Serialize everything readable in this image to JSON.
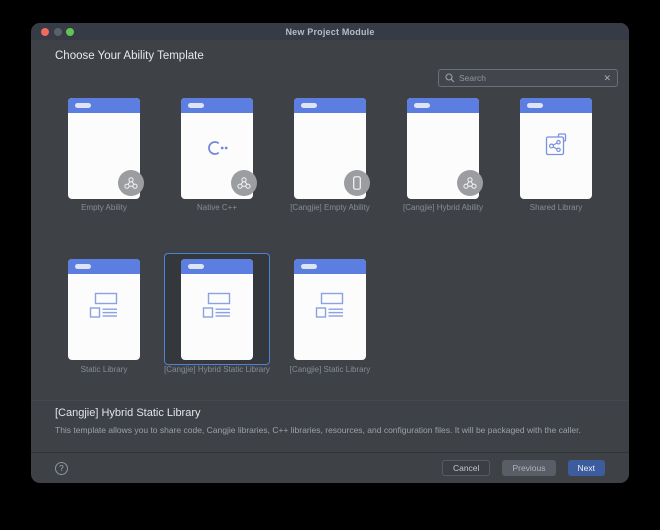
{
  "titlebar": {
    "title": "New Project Module"
  },
  "page": {
    "heading": "Choose Your Ability Template"
  },
  "search": {
    "placeholder": "Search",
    "clear": "✕"
  },
  "templates": [
    {
      "label": "Empty Ability"
    },
    {
      "label": "Native C++"
    },
    {
      "label": "[Cangjie] Empty Ability"
    },
    {
      "label": "[Cangjie] Hybrid Ability"
    },
    {
      "label": "Shared Library"
    },
    {
      "label": "Static Library"
    },
    {
      "label": "[Cangjie] Hybrid Static Library",
      "selected": "true"
    },
    {
      "label": "[Cangjie] Static Library"
    }
  ],
  "description": {
    "title": "[Cangjie] Hybrid Static Library",
    "body": "This template allows you to share code, Cangjie libraries, C++ libraries, resources, and configuration files. It will be packaged with the caller."
  },
  "footer": {
    "help": "?",
    "cancel": "Cancel",
    "previous": "Previous",
    "next": "Next"
  },
  "colors": {
    "window_bg": "#3E4247",
    "titlebar_bg": "#363B46",
    "card_header_blue": "#5B7EE0",
    "selection_border": "#4E81D8",
    "badge_gray": "#9C9DA1",
    "icon_blue": "#7B91DE",
    "next_button_blue": "#3D5C9E",
    "traffic_red": "#EC6A5E",
    "traffic_gray": "#5B616C",
    "traffic_green": "#61C454"
  }
}
